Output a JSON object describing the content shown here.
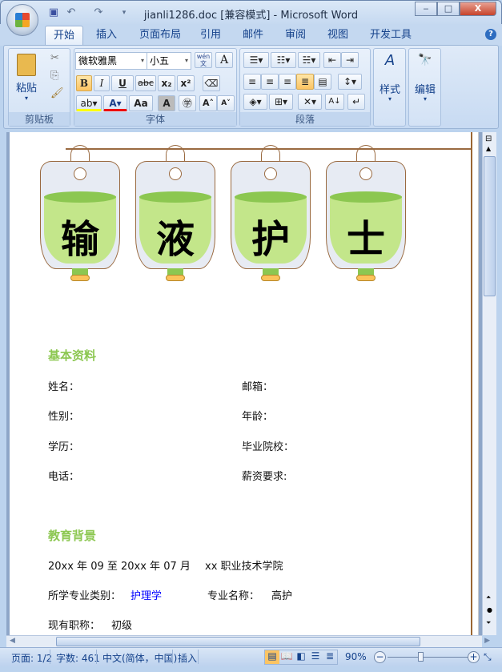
{
  "window": {
    "title": "jianli1286.doc [兼容模式] - Microsoft Word",
    "minimize": "‒",
    "maximize": "□",
    "close": "X"
  },
  "tabs": [
    "开始",
    "插入",
    "页面布局",
    "引用",
    "邮件",
    "审阅",
    "视图",
    "开发工具"
  ],
  "ribbon": {
    "clipboard": {
      "label": "剪贴板",
      "paste": "粘贴"
    },
    "font": {
      "label": "字体",
      "font_name": "微软雅黑",
      "font_size": "小五",
      "bold": "B",
      "italic": "I",
      "underline": "U",
      "strike": "abc",
      "sub": "x₂",
      "sup": "x²",
      "grow": "A˄",
      "shrink": "A˅",
      "aa": "Aa",
      "phonetic": "wén 文"
    },
    "paragraph": {
      "label": "段落"
    },
    "styles": {
      "label": "样式"
    },
    "editing": {
      "label": "编辑"
    }
  },
  "document": {
    "banner": [
      "输",
      "液",
      "护",
      "士"
    ],
    "section1": "基本资料",
    "fields_left": [
      "姓名：",
      "性别：",
      "学历：",
      "电话："
    ],
    "fields_right": [
      "邮箱：",
      "年龄：",
      "毕业院校：",
      "薪资要求:"
    ],
    "section2": "教育背景",
    "edu_period": "20xx 年 09 至 20xx 年 07 月",
    "edu_school": "xx 职业技术学院",
    "major_cat_label": "所学专业类别：",
    "major_cat": "护理学",
    "major_label": "专业名称：",
    "major": "高护",
    "title_label": "现有职称：",
    "title_value": "初级"
  },
  "status": {
    "page": "页面: 1/2",
    "words": "字数: 461",
    "lang": "中文(简体，中国)",
    "mode": "插入",
    "zoom": "90%",
    "zoom_percent": 90
  },
  "colors": {
    "accent_green": "#8cc751",
    "link_blue": "#0000ff"
  }
}
